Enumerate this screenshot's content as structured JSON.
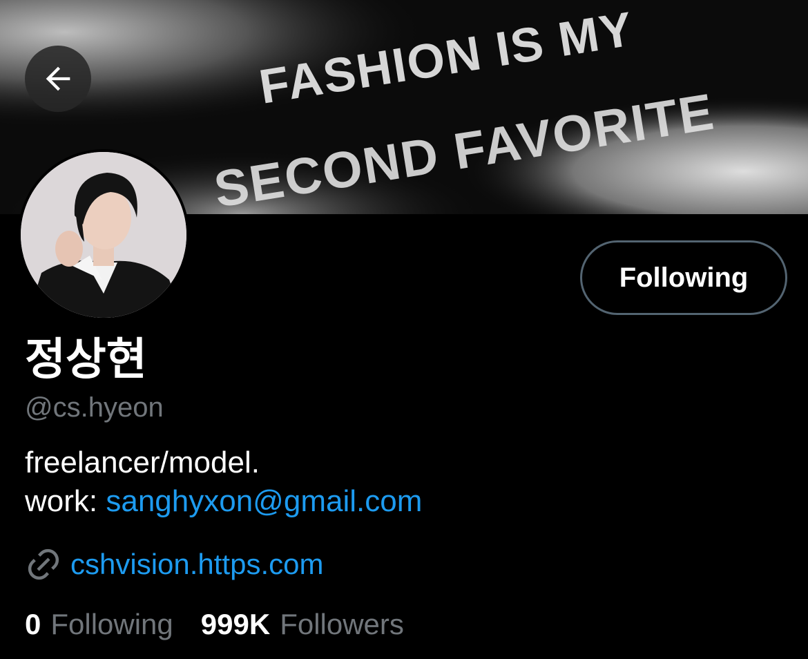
{
  "banner": {
    "text_line1": "FASHION IS MY",
    "text_line2": "SECOND FAVORITE"
  },
  "header": {
    "back_icon": "arrow-left-icon"
  },
  "profile": {
    "display_name": "정상현",
    "handle": "@cs.hyeon",
    "follow_button_label": "Following",
    "bio_line1": "freelancer/model.",
    "bio_work_prefix": "work: ",
    "bio_email": "sanghyxon@gmail.com",
    "website": "cshvision.https.com",
    "website_icon": "link-icon"
  },
  "stats": {
    "following_count": "0",
    "following_label": "Following",
    "followers_count": "999K",
    "followers_label": "Followers"
  },
  "colors": {
    "background": "#000000",
    "link": "#1d9bf0",
    "muted": "#71767b",
    "button_border": "#536471"
  }
}
